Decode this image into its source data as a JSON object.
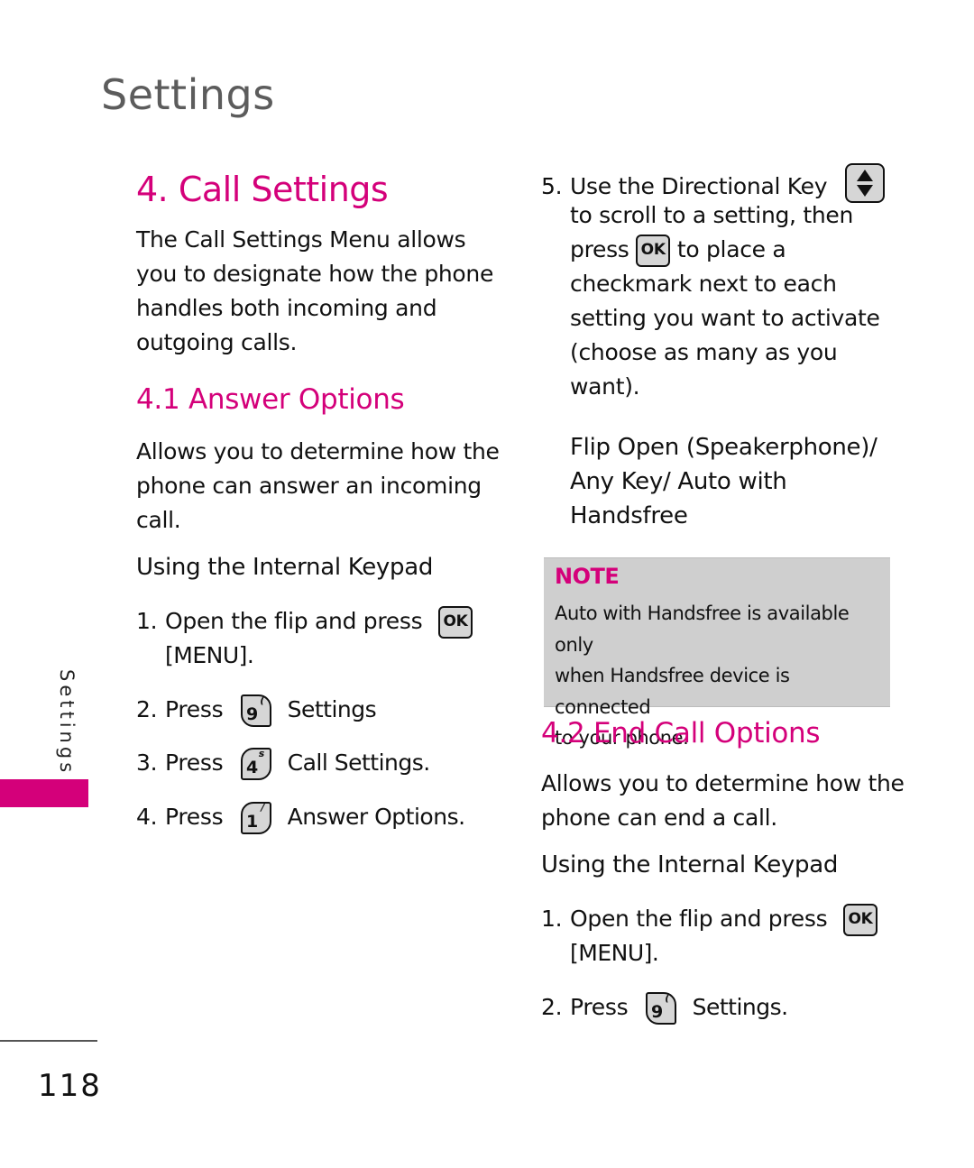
{
  "header": {
    "title": "Settings"
  },
  "sidebar": {
    "label": "Settings",
    "accent_color": "#d4007a"
  },
  "section": {
    "title": "4. Call Settings",
    "intro": [
      "The Call Settings Menu allows",
      "you to designate how the phone",
      "handles both incoming and",
      "outgoing calls."
    ]
  },
  "answer_options": {
    "title": "4.1 Answer Options",
    "description": [
      "Allows you to determine how the",
      "phone can answer an incoming",
      "call."
    ],
    "subhead": "Using the Internal Keypad",
    "steps": [
      {
        "num": "1.",
        "text": "Open the flip and press",
        "key": "OK",
        "suffix": "[MENU]."
      },
      {
        "num": "2.",
        "text": "Press",
        "key": "9",
        "key_sup": "(",
        "suffix": "Settings"
      },
      {
        "num": "3.",
        "text": "Press",
        "key": "4",
        "key_sup": "s",
        "suffix": "Call Settings."
      },
      {
        "num": "4.",
        "text": "Press",
        "key": "1",
        "key_sup": "/",
        "suffix": "Answer Options."
      }
    ]
  },
  "step5": {
    "num": "5.",
    "line1": "Use the Directional Key",
    "line2": "to scroll to a setting, then",
    "line3_pre": "press",
    "line3_key": "OK",
    "line3_post": "to place a",
    "lines_rest": [
      "checkmark next to each",
      "setting you want to activate",
      "(choose as many as you",
      "want)."
    ]
  },
  "options_list": [
    "Flip Open (Speakerphone)/",
    "Any Key/ Auto with",
    "Handsfree"
  ],
  "note": {
    "title": "NOTE",
    "lines": [
      "Auto with Handsfree is available only",
      "when Handsfree device is connected",
      "to your phone."
    ]
  },
  "end_call_options": {
    "title": "4.2 End Call Options",
    "description": [
      "Allows you to determine how the",
      "phone can end a call."
    ],
    "subhead": "Using the Internal Keypad",
    "steps": [
      {
        "num": "1.",
        "text": "Open the flip and press",
        "key": "OK",
        "suffix": "[MENU]."
      },
      {
        "num": "2.",
        "text": "Press",
        "key": "9",
        "key_sup": "(",
        "suffix": "Settings."
      }
    ]
  },
  "footer": {
    "page_number": "118"
  }
}
